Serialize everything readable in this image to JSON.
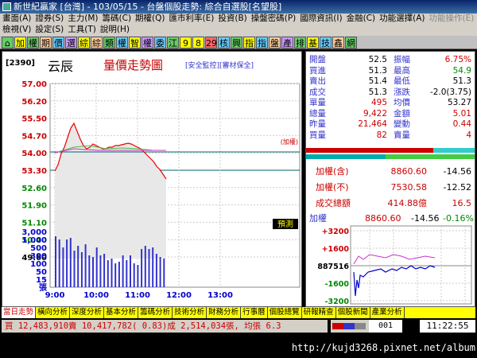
{
  "window": {
    "title": "新世紀贏家 [台灣] - 103/05/15 - 台盤個股走勢: 綜合自選股[名望股]"
  },
  "menu": {
    "row1": [
      "畫面(A)",
      "證券(S)",
      "主力(M)",
      "籌碼(C)",
      "期權(Q)",
      "匯市利率(E)",
      "投資(B)",
      "操盤密碼(P)",
      "國際資訊(I)",
      "金融(C)",
      "功能選擇(A)"
    ],
    "row1_disabled": [
      "功能操作(E)"
    ],
    "row2": [
      "檢視(V)",
      "設定(S)",
      "工具(T)",
      "說明(H)"
    ]
  },
  "toolbar": {
    "buttons": [
      "加",
      "權",
      "期",
      "價",
      "選",
      "綜",
      "綜",
      "類",
      "權",
      "智",
      "權",
      "委",
      "江",
      "9",
      "8",
      "29",
      "核",
      "興",
      "指",
      "指",
      "盤",
      "產",
      "排",
      "基",
      "技",
      "鑫",
      "網"
    ]
  },
  "chart": {
    "code": "[2390]",
    "name": "云辰",
    "title": "量價走勢圖",
    "tags": "[安全監控][審材保全]",
    "ref_label": "(加權)",
    "price_labels": [
      "57.00",
      "56.20",
      "55.50",
      "54.70",
      "54.00",
      "53.30",
      "52.60",
      "51.90",
      "51.10",
      "50.40",
      "49.60"
    ],
    "ref_price": "53.30",
    "vol_labels": [
      "3,000",
      "1,000",
      "500",
      "300",
      "100",
      "50",
      "15",
      "張"
    ],
    "time_labels": [
      "9:00",
      "10:00",
      "11:00",
      "12:00",
      "13:00"
    ],
    "vol_cursor_label": "預測"
  },
  "quote": {
    "rows": [
      {
        "l1": "開盤",
        "v1": "52.5",
        "l2": "振幅",
        "v2": "6.75%",
        "c1": "#000",
        "c2": "#c00"
      },
      {
        "l1": "買進",
        "v1": "51.3",
        "l2": "最高",
        "v2": "54.9",
        "c1": "#000",
        "c2": "#080"
      },
      {
        "l1": "賣出",
        "v1": "51.4",
        "l2": "最低",
        "v2": "51.3",
        "c1": "#000",
        "c2": "#000"
      },
      {
        "l1": "成交",
        "v1": "51.3",
        "l2": "漲跌",
        "v2": "-2.0(3.75)",
        "c1": "#000",
        "c2": "#000"
      },
      {
        "l1": "單量",
        "v1": "495",
        "l2": "均價",
        "v2": "53.27",
        "c1": "#c00",
        "c2": "#000"
      },
      {
        "l1": "總量",
        "v1": "9,422",
        "l2": "金額",
        "v2": "5.01",
        "c1": "#c00",
        "c2": "#c00"
      },
      {
        "l1": "昨量",
        "v1": "21,464",
        "l2": "變動",
        "v2": "0.44",
        "c1": "#c00",
        "c2": "#c00"
      },
      {
        "l1": "買量",
        "v1": "82",
        "l2": "賣量",
        "v2": "4",
        "c1": "#c00",
        "c2": "#c00"
      }
    ]
  },
  "index": {
    "rows": [
      {
        "label": "加權(含)",
        "v1": "8860.60",
        "v2": "-14.56"
      },
      {
        "label": "加權(不)",
        "v1": "7530.58",
        "v2": "-12.52"
      },
      {
        "label": "成交總額",
        "v1": "414.88億",
        "v2": "16.5"
      }
    ]
  },
  "mini": {
    "label": "加權",
    "value": "8860.60",
    "change": "-14.56",
    "pct": "-0.16%",
    "ylabels": [
      "+3200",
      "+1600",
      "887516",
      "-1600",
      "-3200"
    ]
  },
  "tabs": [
    "當日走勢",
    "橫向分析",
    "深度分析",
    "基本分析",
    "籌碼分析",
    "技術分析",
    "財務分析",
    "行事曆",
    "個股總覽",
    "研報精查",
    "個股新聞",
    "產業分析"
  ],
  "status": {
    "ticker": "買 12,483,910賣 10,417,782( 0.83)成 2,514,034張, 均張 6.3",
    "count": "001",
    "clock": "11:22:55"
  },
  "watermark": "http://kujd3268.pixnet.net/album",
  "colors": {
    "up": "#c00",
    "down": "#080",
    "accent": "#33c"
  }
}
